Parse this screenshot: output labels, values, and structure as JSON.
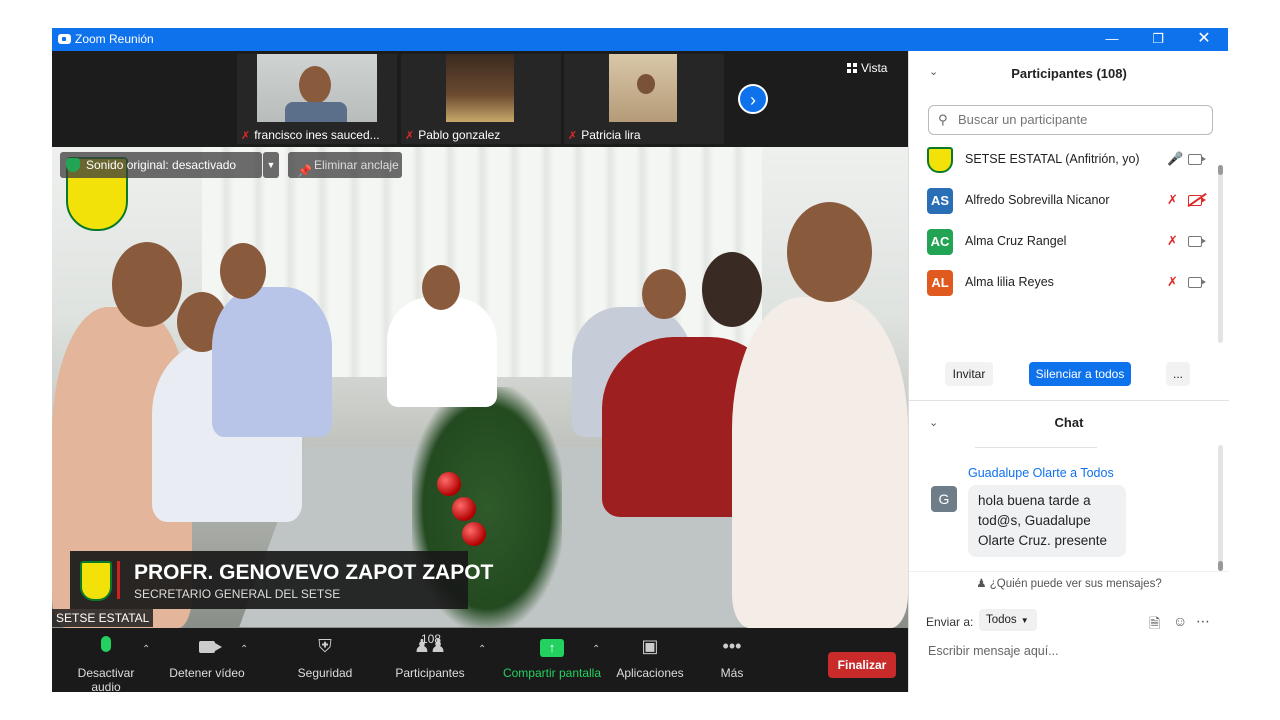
{
  "window": {
    "title": "Zoom Reunión"
  },
  "thumbnails": [
    {
      "name": "francisco ines sauced..."
    },
    {
      "name": "Pablo gonzalez"
    },
    {
      "name": "Patricia lira"
    }
  ],
  "view_label": "Vista",
  "overlay": {
    "original_sound": "Sonido original: desactivado",
    "unpin": "Eliminar anclaje"
  },
  "lower_third": {
    "name": "PROFR. GENOVEVO ZAPOT ZAPOT",
    "role": "SECRETARIO GENERAL DEL SETSE"
  },
  "active_speaker": "SETSE ESTATAL",
  "toolbar": {
    "mute": "Desactivar audio",
    "video": "Detener vídeo",
    "security": "Seguridad",
    "participants": "Participantes",
    "participants_count": "108",
    "share": "Compartir pantalla",
    "apps": "Aplicaciones",
    "more": "Más",
    "end": "Finalizar"
  },
  "participants_panel": {
    "title": "Participantes (108)",
    "search_placeholder": "Buscar un participante",
    "list": [
      {
        "initials": "",
        "name": "SETSE ESTATAL (Anfitrión, yo)",
        "color": "#f2e20a",
        "muted": false,
        "video_off": false
      },
      {
        "initials": "AS",
        "name": "Alfredo Sobrevilla Nicanor",
        "color": "#2a6fb5",
        "muted": true,
        "video_off": true
      },
      {
        "initials": "AC",
        "name": "Alma Cruz Rangel",
        "color": "#23a455",
        "muted": true,
        "video_off": false
      },
      {
        "initials": "AL",
        "name": "Alma lilia Reyes",
        "color": "#e0591f",
        "muted": true,
        "video_off": false
      }
    ],
    "invite": "Invitar",
    "mute_all": "Silenciar a todos",
    "more": "..."
  },
  "chat": {
    "title": "Chat",
    "message": {
      "from": "Guadalupe Olarte a Todos",
      "avatar": "G",
      "text": "hola buena tarde a tod@s, Guadalupe Olarte Cruz. presente"
    },
    "who_sees": "¿Quién puede ver sus mensajes?",
    "send_to_label": "Enviar a:",
    "send_to_value": "Todos",
    "input_placeholder": "Escribir mensaje aquí..."
  }
}
